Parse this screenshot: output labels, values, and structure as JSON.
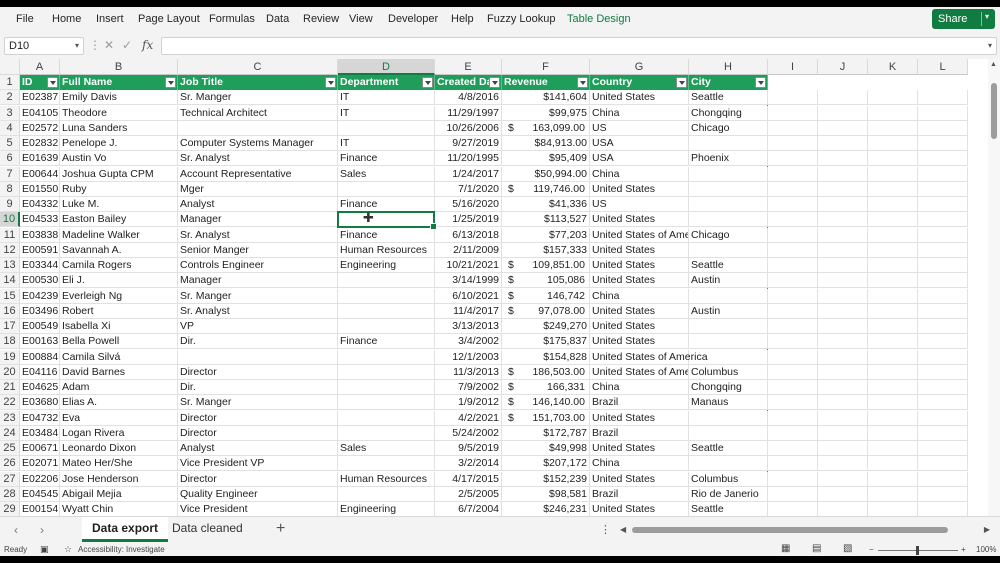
{
  "ribbon": {
    "items": [
      "File",
      "Home",
      "Insert",
      "Page Layout",
      "Formulas",
      "Data",
      "Review",
      "View",
      "Developer",
      "Help",
      "Fuzzy Lookup",
      "Table Design"
    ],
    "share_label": "Share"
  },
  "formula_bar": {
    "name_box": "D10",
    "fx": "fx",
    "value": ""
  },
  "columns": [
    "A",
    "B",
    "C",
    "D",
    "E",
    "F",
    "G",
    "H",
    "I",
    "J",
    "K",
    "L"
  ],
  "selected_column": "D",
  "selected_row": 10,
  "header": [
    "ID",
    "Full Name",
    "Job Title",
    "Department",
    "Created Da",
    "Revenue",
    "Country",
    "City"
  ],
  "rows": [
    [
      "E02387",
      "Emily Davis",
      "Sr. Manger",
      "IT",
      "4/8/2016",
      "$141,604",
      "United States",
      "Seattle"
    ],
    [
      "E04105",
      "Theodore",
      "Technical Architect",
      "IT",
      "11/29/1997",
      "$99,975",
      "China",
      "Chongqing"
    ],
    [
      "E02572",
      "Luna Sanders",
      "",
      "",
      "10/26/2006",
      "$ 163,099.00",
      "US",
      "Chicago"
    ],
    [
      "E02832",
      "Penelope J.",
      "Computer Systems Manager",
      "IT",
      "9/27/2019",
      "$84,913.00",
      "USA",
      ""
    ],
    [
      "E01639",
      "Austin Vo",
      "Sr. Analyst",
      "Finance",
      "11/20/1995",
      "$95,409",
      "USA",
      "Phoenix"
    ],
    [
      "E00644",
      "Joshua Gupta CPM",
      "Account Representative",
      "Sales",
      "1/24/2017",
      "$50,994.00",
      "China",
      ""
    ],
    [
      "E01550",
      "Ruby",
      "Mger",
      "",
      "7/1/2020",
      "$ 119,746.00",
      "United States",
      ""
    ],
    [
      "E04332",
      "Luke M.",
      "Analyst",
      "Finance",
      "5/16/2020",
      "$41,336",
      "US",
      ""
    ],
    [
      "E04533",
      "Easton Bailey",
      "Manager",
      "",
      "1/25/2019",
      "$113,527",
      "United States",
      ""
    ],
    [
      "E03838",
      "Madeline Walker",
      "Sr. Analyst",
      "Finance",
      "6/13/2018",
      "$77,203",
      "United States of Ame",
      "Chicago"
    ],
    [
      "E00591",
      "Savannah A.",
      "Senior Manger",
      "Human Resources",
      "2/11/2009",
      "$157,333",
      "United States",
      ""
    ],
    [
      "E03344",
      "Camila Rogers",
      "Controls Engineer",
      "Engineering",
      "10/21/2021",
      "$ 109,851.00",
      "United States",
      "Seattle"
    ],
    [
      "E00530",
      "Eli J.",
      "Manager",
      "",
      "3/14/1999",
      "$ 105,086",
      "United States",
      "Austin"
    ],
    [
      "E04239",
      "Everleigh Ng",
      "Sr. Manger",
      "",
      "6/10/2021",
      "$ 146,742",
      "China",
      ""
    ],
    [
      "E03496",
      "Robert",
      "Sr. Analyst",
      "",
      "11/4/2017",
      "$ 97,078.00",
      "United States",
      "Austin"
    ],
    [
      "E00549",
      "Isabella Xi",
      "VP",
      "",
      "3/13/2013",
      "$249,270",
      "United States",
      ""
    ],
    [
      "E00163",
      "Bella Powell",
      "Dir.",
      "Finance",
      "3/4/2002",
      "$175,837",
      "United States",
      ""
    ],
    [
      "E00884",
      "Camila Silvá",
      "",
      "",
      "12/1/2003",
      "$154,828",
      "United States of America",
      ""
    ],
    [
      "E04116",
      "David Barnes",
      "Director",
      "",
      "11/3/2013",
      "$ 186,503.00",
      "United States of Ame",
      "Columbus"
    ],
    [
      "E04625",
      "Adam",
      "Dir.",
      "",
      "7/9/2002",
      "$ 166,331",
      "China",
      "Chongqing"
    ],
    [
      "E03680",
      "Elias A.",
      "Sr. Manger",
      "",
      "1/9/2012",
      "$ 146,140.00",
      "Brazil",
      "Manaus"
    ],
    [
      "E04732",
      "Eva",
      "Director",
      "",
      "4/2/2021",
      "$ 151,703.00",
      "United States",
      ""
    ],
    [
      "E03484",
      "Logan Rivera",
      "Director",
      "",
      "5/24/2002",
      "$172,787",
      "Brazil",
      ""
    ],
    [
      "E00671",
      "Leonardo Dixon",
      "Analyst",
      "Sales",
      "9/5/2019",
      "$49,998",
      "United States",
      "Seattle"
    ],
    [
      "E02071",
      "Mateo Her/She",
      "Vice President VP",
      "",
      "3/2/2014",
      "$207,172",
      "China",
      ""
    ],
    [
      "E02206",
      "Jose Henderson",
      "Director",
      "Human Resources",
      "4/17/2015",
      "$152,239",
      "United States",
      "Columbus"
    ],
    [
      "E04545",
      "Abigail Mejia",
      "Quality Engineer",
      "",
      "2/5/2005",
      "$98,581",
      "Brazil",
      "Rio de Janerio"
    ],
    [
      "E00154",
      "Wyatt Chin",
      "Vice President",
      "Engineering",
      "6/7/2004",
      "$246,231",
      "United States",
      "Seattle"
    ]
  ],
  "sheets": [
    "Data export",
    "Data cleaned"
  ],
  "active_sheet": "Data export",
  "status": {
    "ready": "Ready",
    "accessibility": "Accessibility: Investigate",
    "zoom": "100%"
  }
}
